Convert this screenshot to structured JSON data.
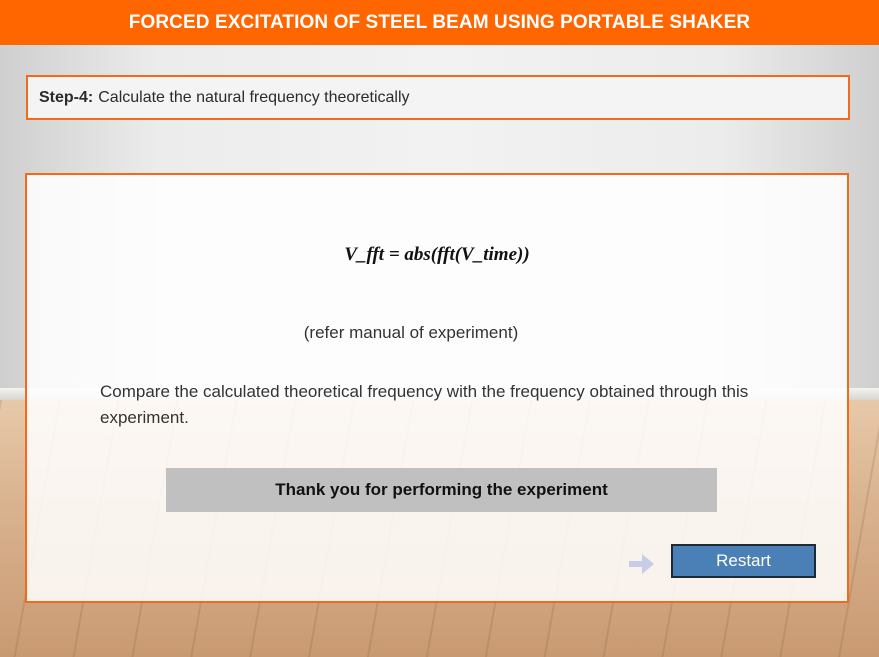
{
  "header": {
    "title": "FORCED EXCITATION OF STEEL BEAM USING PORTABLE SHAKER"
  },
  "step": {
    "label": "Step-4:",
    "text": "Calculate the natural frequency theoretically"
  },
  "panel": {
    "formula": "V_fft = abs(fft(V_time))",
    "refer_note": "(refer manual of experiment)",
    "compare_text": "Compare the calculated theoretical frequency with the frequency obtained through this experiment.",
    "thanks_text": "Thank you for performing the experiment",
    "restart_label": "Restart"
  },
  "icons": {
    "next_arrow": "arrow-right-icon"
  },
  "colors": {
    "accent": "#ff6600",
    "border": "#f26b1d",
    "restart_button": "#4a80b5",
    "thanks_bar": "#c0c0c0",
    "arrow": "#c7cde6"
  }
}
